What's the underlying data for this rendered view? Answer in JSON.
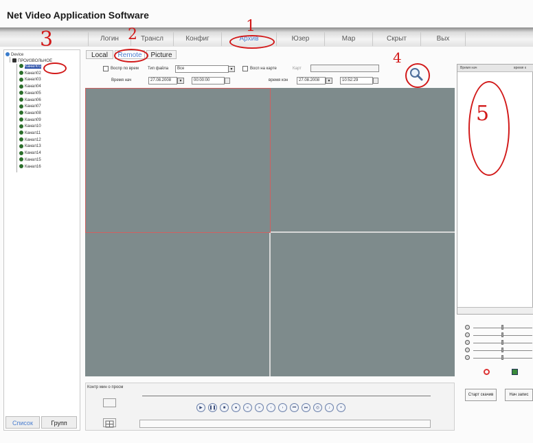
{
  "app": {
    "title": "Net Video Application Software"
  },
  "toolbar": {
    "items": [
      "Логин",
      "Трансл",
      "Конфиг",
      "Архив",
      "Юзер",
      "Мар",
      "Скрыт",
      "Вых"
    ]
  },
  "tree": {
    "root": "Device",
    "area": "ПРОИЗВОЛЬНОЕ",
    "channels": [
      "Канал01",
      "Канал02",
      "Канал03",
      "Канал04",
      "Канал05",
      "Канал06",
      "Канал07",
      "Канал08",
      "Канал09",
      "Канал10",
      "Канал11",
      "Канал12",
      "Канал13",
      "Канал14",
      "Канал15",
      "Канал16"
    ],
    "selected_channel": "Канал01"
  },
  "left_tabs": {
    "list": "Список",
    "group": "Групп"
  },
  "view_tabs": {
    "local": "Local",
    "remote": "Remote",
    "picture": "Picture"
  },
  "filters": {
    "by_time_label": "Воспр по врем",
    "file_type_label": "Тип файла",
    "file_type_value": "Все",
    "by_map_label": "Восп на карте",
    "card_label": "Карт",
    "start_time_label": "Время нач",
    "start_date": "27.08.2008",
    "start_time": "00:00:00",
    "end_time_label": "время кон",
    "end_date": "27.08.2008",
    "end_time": "10:52:29"
  },
  "results": {
    "col_start": "Время нач",
    "col_end": "время к"
  },
  "playback": {
    "progress_label": "Контр мин о просм"
  },
  "actions": {
    "start_download": "Старт скачив",
    "start_record": "Нач запис"
  },
  "annotations": {
    "n1": "1",
    "n2": "2",
    "n3": "3",
    "n4": "4",
    "n5": "5"
  }
}
